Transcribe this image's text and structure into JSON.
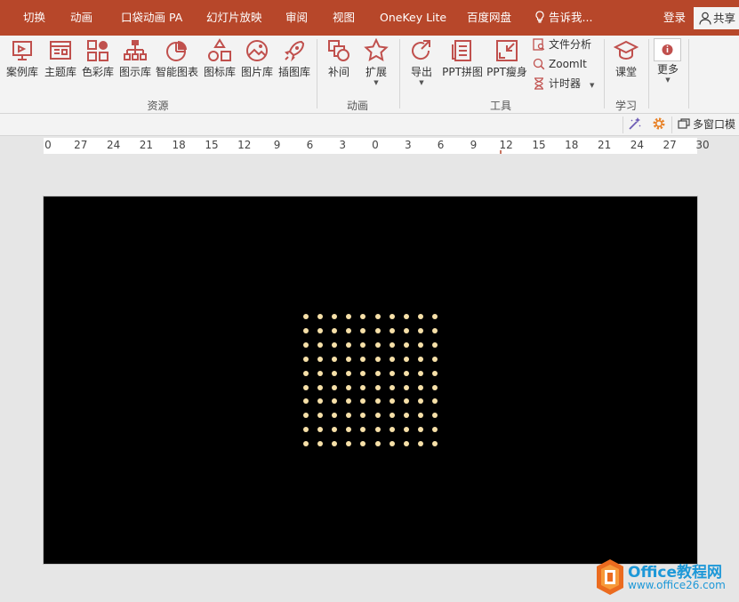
{
  "tabs": [
    {
      "label": "切换"
    },
    {
      "label": "动画"
    },
    {
      "label": "口袋动画 PA"
    },
    {
      "label": "幻灯片放映"
    },
    {
      "label": "审阅"
    },
    {
      "label": "视图"
    },
    {
      "label": "OneKey Lite"
    },
    {
      "label": "百度网盘"
    }
  ],
  "tell_me": "告诉我...",
  "login": "登录",
  "share": "共享",
  "ribbon": {
    "resources": [
      {
        "label": "案例库",
        "icon": "case-library-icon"
      },
      {
        "label": "主题库",
        "icon": "theme-library-icon"
      },
      {
        "label": "色彩库",
        "icon": "color-library-icon"
      },
      {
        "label": "图示库",
        "icon": "diagram-library-icon"
      },
      {
        "label": "智能图表",
        "icon": "smart-chart-icon"
      },
      {
        "label": "图标库",
        "icon": "icon-library-icon"
      },
      {
        "label": "图片库",
        "icon": "picture-library-icon"
      },
      {
        "label": "插图库",
        "icon": "illustration-library-icon"
      }
    ],
    "resources_group": "资源",
    "anim": [
      {
        "label": "补间",
        "icon": "tween-icon"
      },
      {
        "label": "扩展",
        "icon": "star-icon"
      }
    ],
    "anim_group": "动画",
    "tools": [
      {
        "label": "导出",
        "icon": "export-icon"
      },
      {
        "label": "PPT拼图",
        "icon": "ppt-puzzle-icon"
      },
      {
        "label": "PPT瘦身",
        "icon": "ppt-slim-icon"
      }
    ],
    "tools_small": [
      {
        "label": "文件分析",
        "icon": "file-analysis-icon"
      },
      {
        "label": "ZoomIt",
        "icon": "zoom-icon"
      },
      {
        "label": "计时器",
        "icon": "hourglass-icon"
      }
    ],
    "tools_group": "工具",
    "learn": {
      "label": "课堂",
      "icon": "graduation-cap-icon"
    },
    "learn_group": "学习",
    "more": {
      "label": "更多",
      "icon": "info-icon"
    }
  },
  "subbar": {
    "multi_window": "多窗口模"
  },
  "ruler": [
    "0",
    "27",
    "24",
    "21",
    "18",
    "15",
    "12",
    "9",
    "6",
    "3",
    "0",
    "3",
    "6",
    "9",
    "12",
    "15",
    "18",
    "21",
    "24",
    "27",
    "30"
  ],
  "slide": {
    "background": "#000000",
    "dot_color": "#f6e0a8",
    "dot_rows": 10,
    "dot_cols": 10
  },
  "watermark": {
    "title": "Office教程网",
    "url": "www.office26.com"
  },
  "colors": {
    "accent": "#b7472a",
    "ribbon_icon": "#c0504d",
    "watermark": "#1d98d8"
  }
}
